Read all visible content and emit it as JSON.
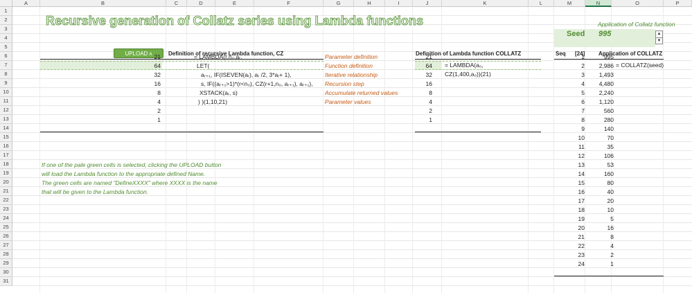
{
  "columns": [
    "A",
    "B",
    "C",
    "D",
    "E",
    "F",
    "G",
    "H",
    "I",
    "J",
    "K",
    "L",
    "M",
    "N",
    "O",
    "P"
  ],
  "rows": [
    "1",
    "2",
    "3",
    "4",
    "5",
    "6",
    "7",
    "8",
    "9",
    "10",
    "11",
    "12",
    "13",
    "14",
    "15",
    "16",
    "17",
    "18",
    "19",
    "20",
    "21",
    "22",
    "23",
    "24",
    "25",
    "26",
    "27",
    "28",
    "29",
    "30",
    "31"
  ],
  "title": "Recursive generation of Collatz series using Lambda functions",
  "upload_button": "UPLOAD ʌ",
  "cz": {
    "header": "Definition of recursive Lambda function, CZ",
    "values": [
      "21",
      "64",
      "32",
      "16",
      "8",
      "4",
      "2",
      "1"
    ],
    "formula_lines": [
      "= LAMBDA(r,n₀,aᵣ,",
      "LET(",
      "aᵣ₊₁, IF(ISEVEN(aᵣ), aᵣ /2, 3*aᵣ+ 1),",
      "s, IF((aᵣ₊₁>1)*(r<n₀), CZ(r+1,n₀, aᵣ₊₁), aᵣ₊₁),",
      "XSTACK(aᵣ, s)",
      ") )(1,10,21)"
    ],
    "notes": [
      "Parameter definition",
      "Function definition",
      "Iterative relationship",
      "Recursion step",
      "Accumulate returned values",
      "Parameter values"
    ]
  },
  "collatz": {
    "header": "Definition of Lambda function COLLATZ",
    "values": [
      "21",
      "64",
      "32",
      "16",
      "8",
      "4",
      "2",
      "1"
    ],
    "formula_lines": [
      "= LAMBDA(a₀,",
      "CZ(1,400,a₀))(21)"
    ]
  },
  "help_text": [
    "If one of the pale green cells is selected, clicking the  UPLOAD  button",
    "will load the Lambda function to the appropriate defined Name.",
    "The green cells are named \"DefineXXXX\" where  XXXX  is the name",
    "that will be given to the Lambda function."
  ],
  "application": {
    "caption": "Application of Collatz function",
    "seed_label": "Seed",
    "seed_value": "995",
    "col_seq": "Seq",
    "col_count": "[24]",
    "col_app": "Application of COLLATZ",
    "formula": "= COLLATZ(seed)",
    "seq": [
      "1",
      "2",
      "3",
      "4",
      "5",
      "6",
      "7",
      "8",
      "9",
      "10",
      "11",
      "12",
      "13",
      "14",
      "15",
      "16",
      "17",
      "18",
      "19",
      "20",
      "21",
      "22",
      "23",
      "24"
    ],
    "values": [
      "995",
      "2,986",
      "1,493",
      "4,480",
      "2,240",
      "1,120",
      "560",
      "280",
      "140",
      "70",
      "35",
      "106",
      "53",
      "160",
      "80",
      "40",
      "20",
      "10",
      "5",
      "16",
      "8",
      "4",
      "2",
      "1"
    ]
  },
  "spinner": {
    "up": "▲",
    "down": "▼"
  }
}
